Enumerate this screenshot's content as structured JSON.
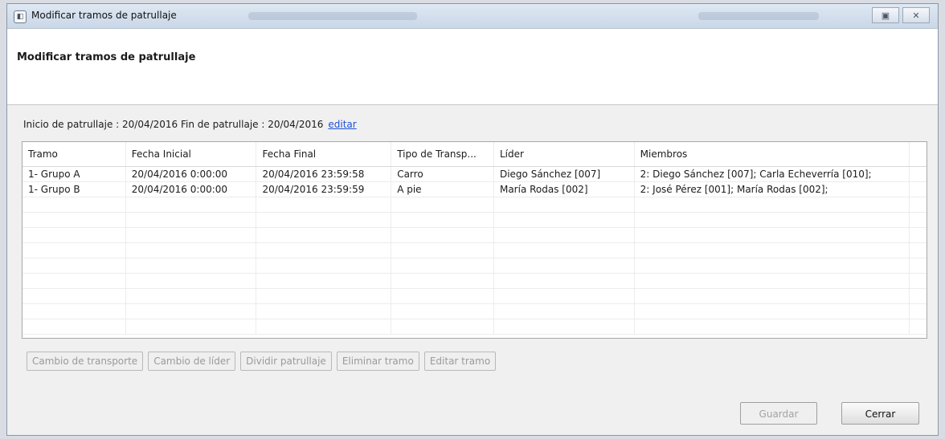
{
  "window": {
    "title": "Modificar tramos de patrullaje",
    "controls": {
      "maximize": "▣",
      "close": "✕"
    }
  },
  "header": {
    "title": "Modificar tramos de patrullaje"
  },
  "patrol_info": {
    "text": "Inicio de patrullaje : 20/04/2016  Fin de patrullaje : 20/04/2016",
    "edit_link": "editar"
  },
  "table": {
    "columns": [
      "Tramo",
      "Fecha Inicial",
      "Fecha Final",
      "Tipo de Transp...",
      "Líder",
      "Miembros"
    ],
    "rows": [
      [
        "1- Grupo A",
        "20/04/2016 0:00:00",
        "20/04/2016 23:59:58",
        "Carro",
        "Diego Sánchez [007]",
        "2: Diego Sánchez [007]; Carla Echeverría [010];"
      ],
      [
        "1- Grupo B",
        "20/04/2016 0:00:00",
        "20/04/2016 23:59:59",
        "A pie",
        "María Rodas [002]",
        "2: José Pérez [001]; María Rodas [002];"
      ]
    ]
  },
  "actions": {
    "change_transport": "Cambio de transporte",
    "change_leader": "Cambio de líder",
    "split_patrol": "Dividir patrullaje",
    "delete_segment": "Eliminar tramo",
    "edit_segment": "Editar tramo"
  },
  "footer": {
    "save": "Guardar",
    "close": "Cerrar"
  }
}
